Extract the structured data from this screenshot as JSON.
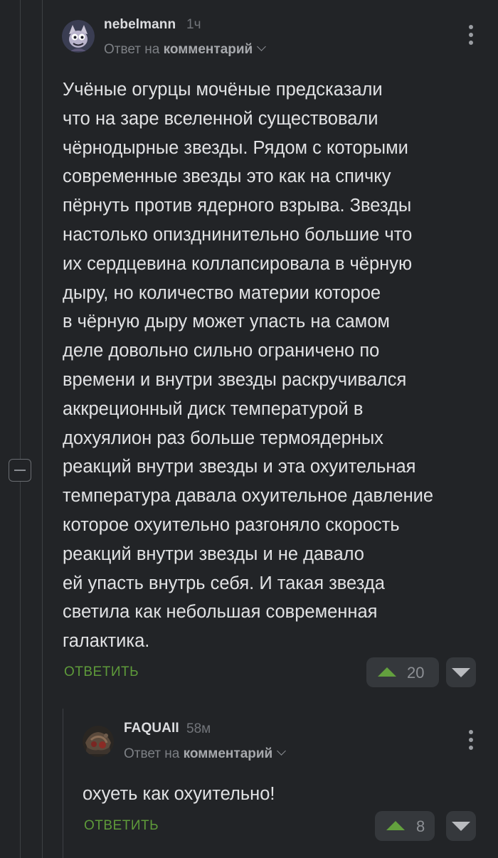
{
  "comment1": {
    "username": "nebelmann",
    "time": "1ч",
    "reply_prefix": "Ответ на",
    "reply_target": "комментарий",
    "body": "Учёные огурцы мочёные предсказали\nчто на заре вселенной существовали\nчёрнодырные звезды. Рядом с которыми\nсовременные звезды это как на спичку\nпёрнуть против ядерного взрыва. Звезды\nнастолько опизднинительно большие что\nих сердцевина коллапсировала в чёрную\nдыру, но количество материи которое\nв чёрную дыру может упасть на самом\nделе довольно сильно ограничено по\nвремени и внутри звезды раскручивался\nаккреционный диск температурой в\nдохуялион раз больше термоядерных\nреакций внутри звезды и эта охуительная\nтемпература давала охуительное давление\nкоторое охуительно разгоняло скорость\nреакций внутри звезды и не давало\nей упасть внутрь себя. И такая звезда\nсветила как небольшая современная\nгалактика.",
    "reply_label": "ОТВЕТИТЬ",
    "rating": "20"
  },
  "comment2": {
    "username": "FAQUAII",
    "time": "58м",
    "reply_prefix": "Ответ на",
    "reply_target": "комментарий",
    "body": "охуеть как охуительно!",
    "reply_label": "ОТВЕТИТЬ",
    "rating": "8"
  },
  "icons": {
    "more": "more-vertical-icon",
    "collapse": "collapse-minus-icon",
    "upvote": "upvote-arrow-icon",
    "downvote": "downvote-arrow-icon",
    "chevron": "chevron-down-icon"
  },
  "colors": {
    "background": "#222427",
    "accent_green": "#5e9a3a",
    "upvote_green": "#63a03e",
    "vote_box": "#35383c",
    "text": "#e1e2e4",
    "muted": "#7d8085"
  }
}
